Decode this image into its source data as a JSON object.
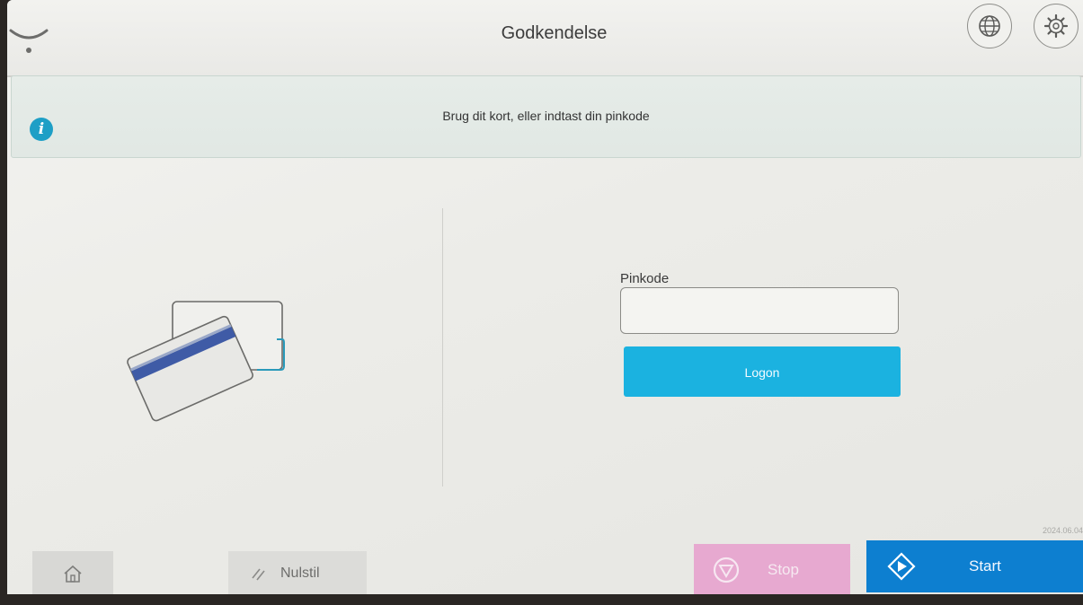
{
  "header": {
    "title": "Godkendelse",
    "logo_icon": "smile-logo-icon",
    "language_icon": "globe-icon",
    "settings_icon": "gear-icon"
  },
  "banner": {
    "icon": "info-icon",
    "icon_glyph": "i",
    "message": "Brug dit kort, eller indtast din pinkode"
  },
  "login": {
    "card_icon": "card-swipe-icon",
    "pin_label": "Pinkode",
    "pin_value": "",
    "logon_label": "Logon"
  },
  "stamp": "2024.06.04",
  "footer": {
    "home_icon": "home-icon",
    "reset_icon": "reset-icon",
    "reset_label": "Nulstil",
    "stop_icon": "stop-icon",
    "stop_label": "Stop",
    "start_icon": "start-icon",
    "start_label": "Start"
  },
  "colors": {
    "accent": "#1bb2e0",
    "info": "#1e9fc6",
    "stop": "#e7a9d0",
    "start": "#0d7fd0",
    "card_stripe": "#3f5ba6"
  }
}
